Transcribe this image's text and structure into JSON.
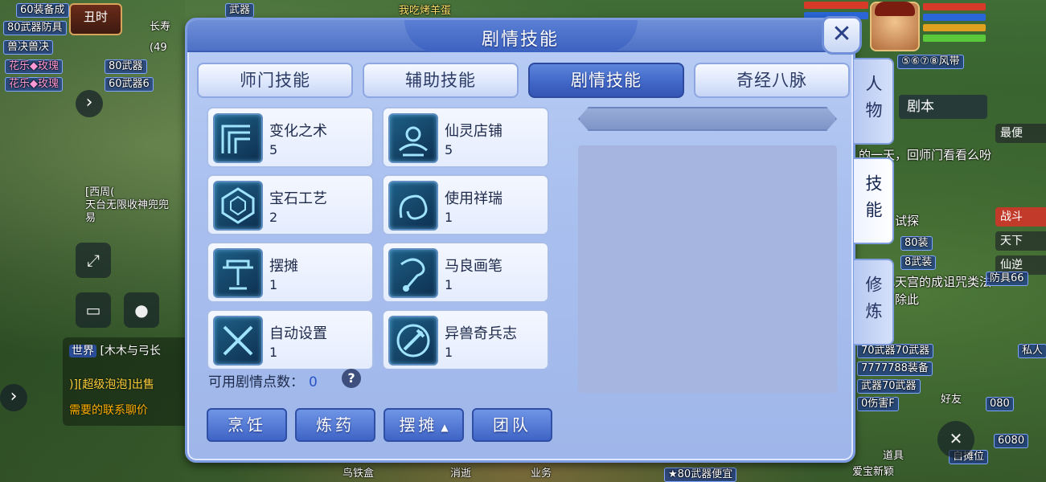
{
  "panel": {
    "title": "剧情技能",
    "close_symbol": "✕"
  },
  "tabs": [
    {
      "label": "师门技能"
    },
    {
      "label": "辅助技能"
    },
    {
      "label": "剧情技能",
      "active": true
    },
    {
      "label": "奇经八脉"
    }
  ],
  "side_tabs": [
    {
      "label": "人物"
    },
    {
      "label": "技能",
      "active": true
    },
    {
      "label": "修炼"
    }
  ],
  "skills": [
    {
      "name": "变化之术",
      "level": "5",
      "icon": "transform-icon"
    },
    {
      "name": "仙灵店铺",
      "level": "5",
      "icon": "shop-icon"
    },
    {
      "name": "宝石工艺",
      "level": "2",
      "icon": "gem-icon"
    },
    {
      "name": "使用祥瑞",
      "level": "1",
      "icon": "auspicious-icon"
    },
    {
      "name": "摆摊",
      "level": "1",
      "icon": "stall-icon"
    },
    {
      "name": "马良画笔",
      "level": "1",
      "icon": "brush-icon"
    },
    {
      "name": "自动设置",
      "level": "1",
      "icon": "crossed-swords-icon"
    },
    {
      "name": "异兽奇兵志",
      "level": "1",
      "icon": "beast-weapon-icon"
    }
  ],
  "points": {
    "label": "可用剧情点数：",
    "value": "0",
    "help": "?"
  },
  "bottom_buttons": [
    {
      "label": "烹饪"
    },
    {
      "label": "炼药"
    },
    {
      "label": "摆摊",
      "caret": "▲"
    },
    {
      "label": "团队"
    }
  ],
  "hud": {
    "time": "丑时",
    "player_level": "(49",
    "map_prefix": "长寿",
    "minimap_label": "剧本",
    "quest_text": "的一天，回师门看看么吩咐吧。",
    "quest_text2": "回话，试探",
    "quest_text3": "后，找天宫的成诅咒类法宝吧，除此",
    "world_tag": "世界",
    "chat_line1": "[木木与弓长",
    "chat_line2": ")][超级泡泡]出售",
    "chat_line3": "需要的联系聊价",
    "chat_sender": "[西周(",
    "chat_msg": "天台无限收神兜兜",
    "chat_msg2": "易"
  },
  "bg_labels": [
    "60装备成",
    "80武器防具",
    "兽决兽决",
    "花乐◆玫瑰",
    "花乐◆玫瑰",
    "80武器",
    "60武器6",
    "我吃烤羊蛋",
    "武器",
    "70武器70武器",
    "7777788装备",
    "武器70武器",
    "0伤害F",
    "防具66",
    "★80武器便宜",
    "私人",
    "最便",
    "天下",
    "仙逆",
    "80装",
    "8武装",
    "⑤⑥⑦⑧风带",
    "6080",
    "080",
    "自摊位",
    "道具",
    "爱宝新颖",
    "好友",
    "战斗",
    "鸟铁盒",
    "消逝",
    "业务"
  ]
}
